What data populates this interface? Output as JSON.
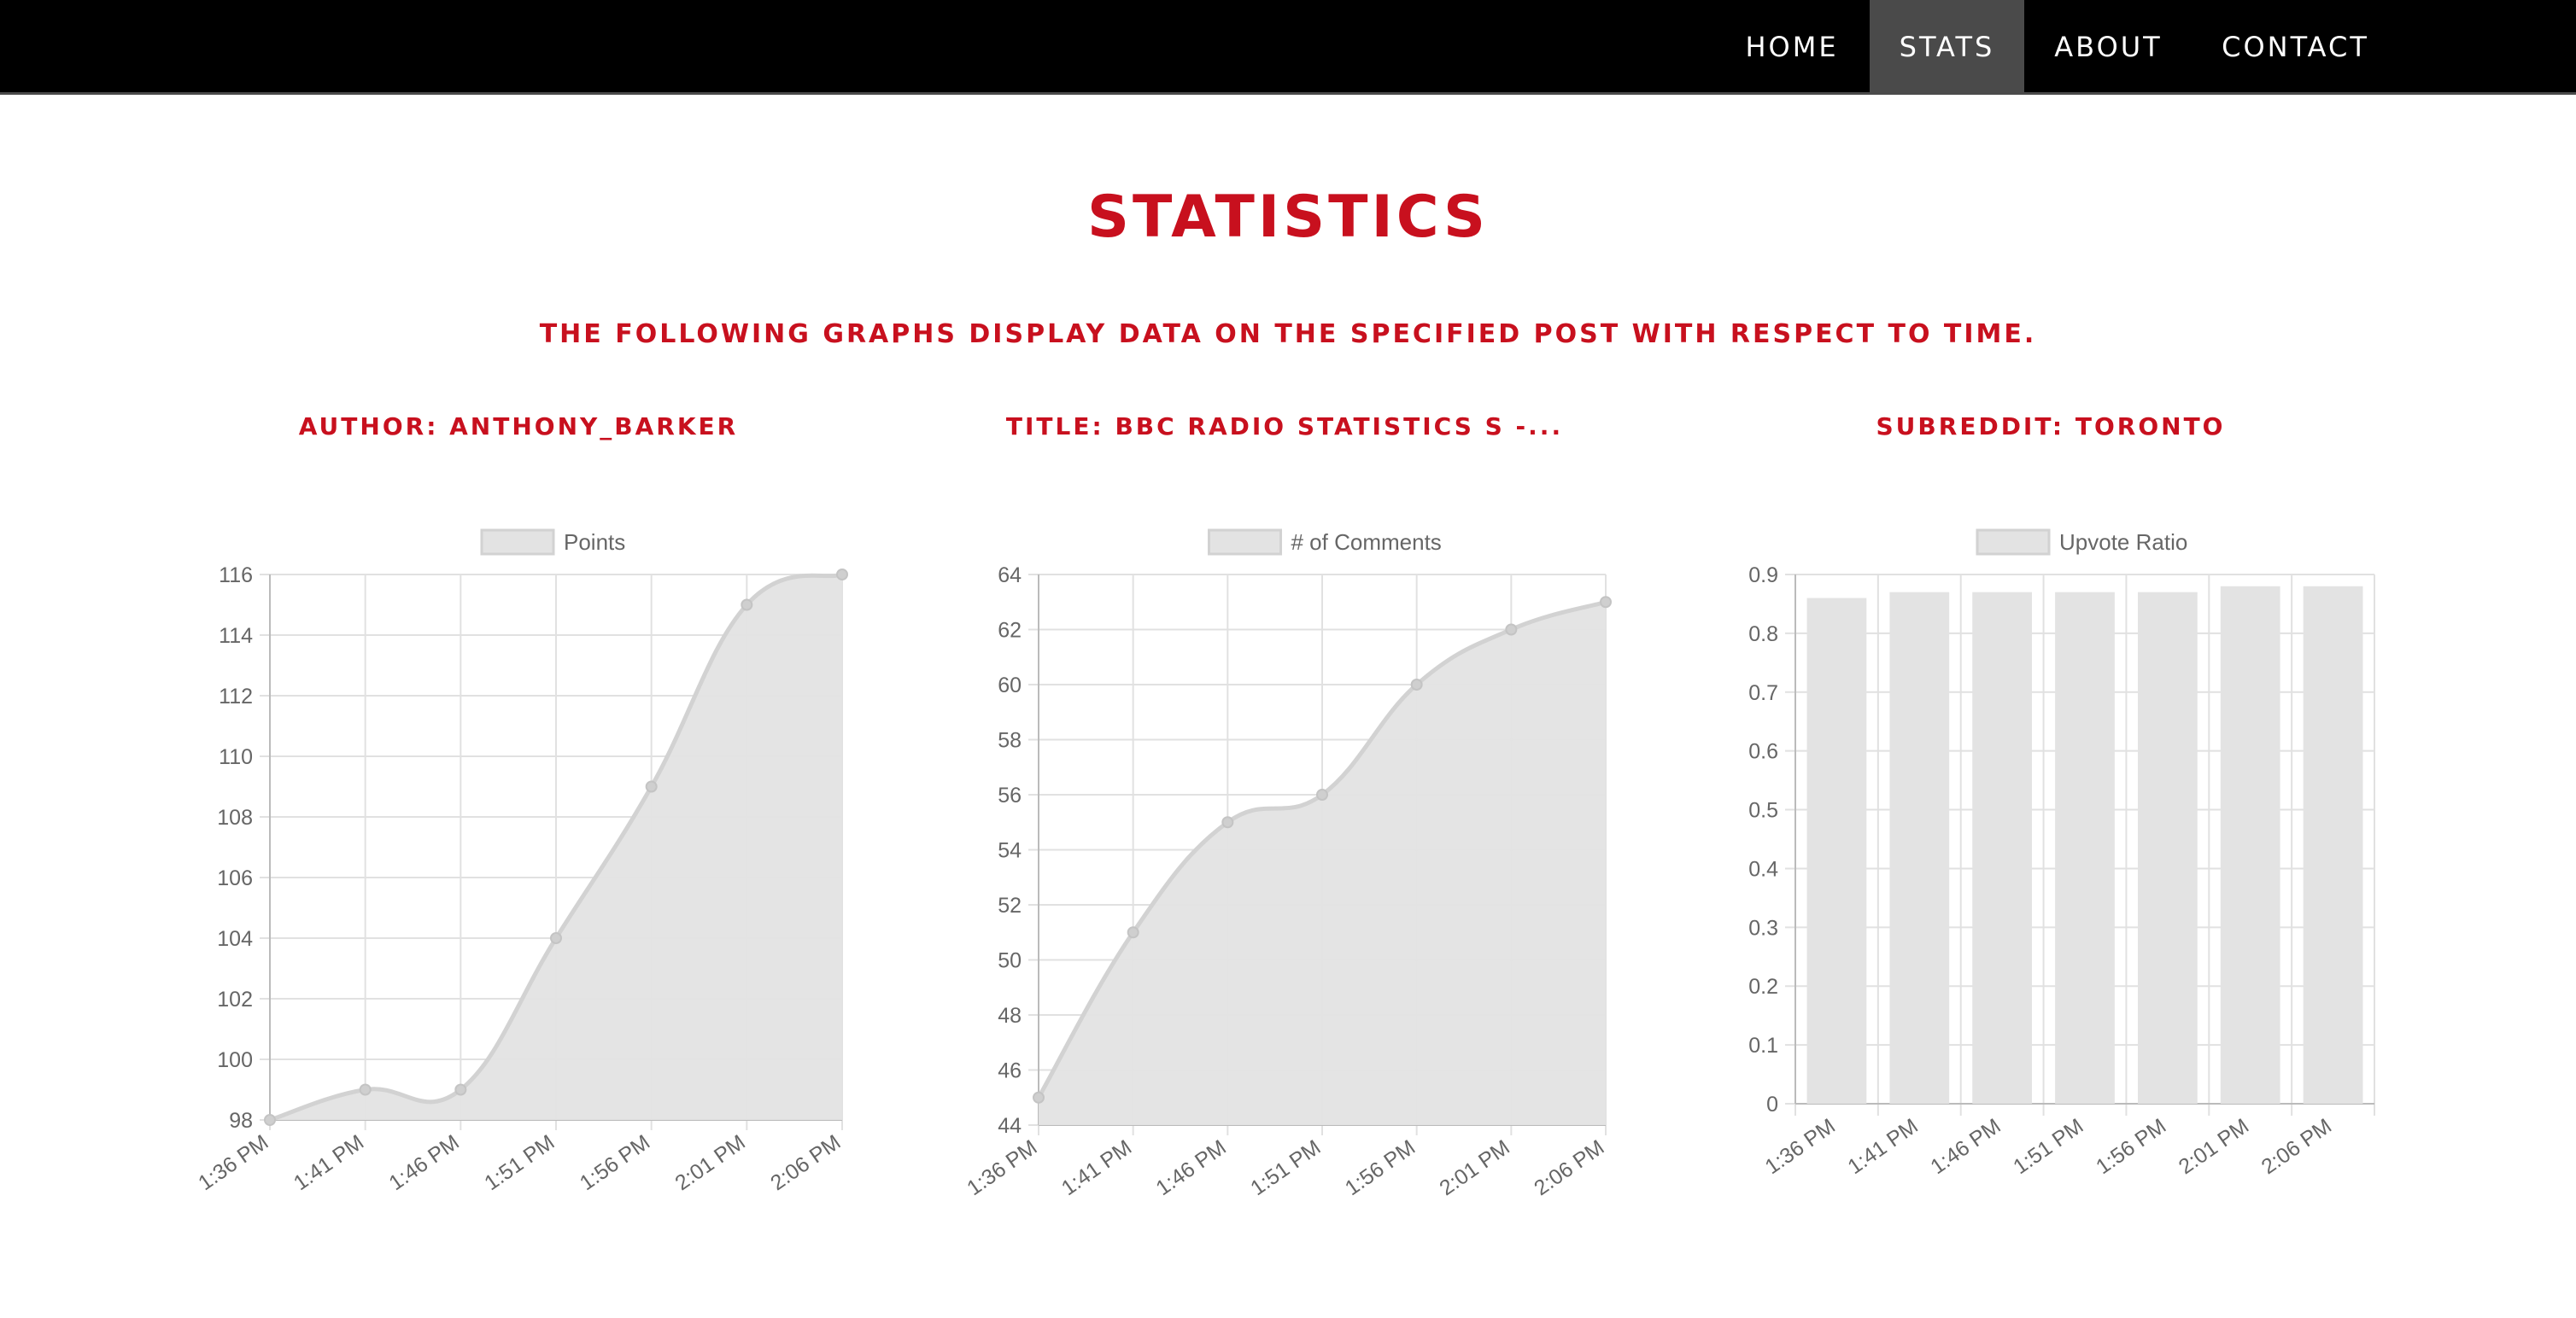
{
  "nav": {
    "items": [
      {
        "label": "HOME",
        "active": false
      },
      {
        "label": "STATS",
        "active": true
      },
      {
        "label": "ABOUT",
        "active": false
      },
      {
        "label": "CONTACT",
        "active": false
      }
    ]
  },
  "page": {
    "title": "STATISTICS",
    "subtitle": "THE FOLLOWING GRAPHS DISPLAY DATA ON THE SPECIFIED POST WITH RESPECT TO TIME."
  },
  "headings": {
    "author": "AUTHOR: ANTHONY_BARKER",
    "title": "TITLE: BBC RADIO STATISTICS S -...",
    "subreddit": "SUBREDDIT: TORONTO"
  },
  "colors": {
    "nav_bg": "#000000",
    "nav_active": "#4a4a4a",
    "accent": "#c8101e",
    "fill": "#e3e3e3",
    "stroke": "#d2d2d2",
    "grid": "#e1e1e1",
    "axis": "#bbbbbb",
    "tick_text": "#666666"
  },
  "chart_data": [
    {
      "type": "line",
      "x": [
        "1:36 PM",
        "1:41 PM",
        "1:46 PM",
        "1:51 PM",
        "1:56 PM",
        "2:01 PM",
        "2:06 PM"
      ],
      "series": [
        {
          "name": "Points",
          "values": [
            98,
            99,
            99,
            104,
            109,
            115,
            116
          ]
        }
      ],
      "ylim": [
        98,
        116
      ],
      "yticks": [
        98,
        100,
        102,
        104,
        106,
        108,
        110,
        112,
        114,
        116
      ],
      "grid": true,
      "legend": "top"
    },
    {
      "type": "line",
      "x": [
        "1:36 PM",
        "1:41 PM",
        "1:46 PM",
        "1:51 PM",
        "1:56 PM",
        "2:01 PM",
        "2:06 PM"
      ],
      "series": [
        {
          "name": "# of Comments",
          "values": [
            45,
            51,
            55,
            56,
            60,
            62,
            63
          ]
        }
      ],
      "ylim": [
        44,
        64
      ],
      "yticks": [
        44,
        46,
        48,
        50,
        52,
        54,
        56,
        58,
        60,
        62,
        64
      ],
      "grid": true,
      "legend": "top"
    },
    {
      "type": "bar",
      "categories": [
        "1:36 PM",
        "1:41 PM",
        "1:46 PM",
        "1:51 PM",
        "1:56 PM",
        "2:01 PM",
        "2:06 PM"
      ],
      "series": [
        {
          "name": "Upvote Ratio",
          "values": [
            0.86,
            0.87,
            0.87,
            0.87,
            0.87,
            0.88,
            0.88
          ]
        }
      ],
      "ylim": [
        0,
        0.9
      ],
      "yticks": [
        0,
        0.1,
        0.2,
        0.3,
        0.4,
        0.5,
        0.6,
        0.7,
        0.8,
        0.9
      ],
      "grid": true,
      "legend": "top"
    }
  ]
}
